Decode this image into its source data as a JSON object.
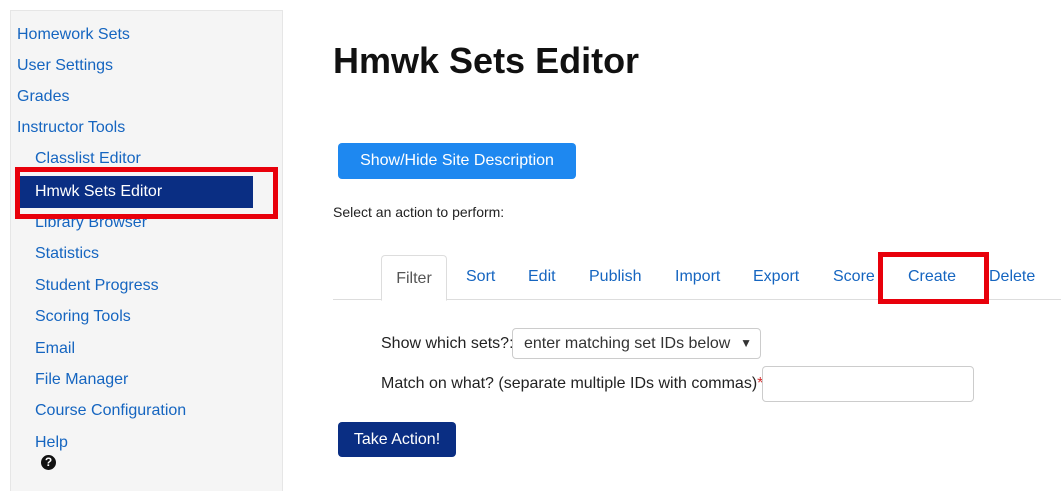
{
  "sidebar": {
    "items": [
      {
        "label": "Homework Sets"
      },
      {
        "label": "User Settings"
      },
      {
        "label": "Grades"
      },
      {
        "label": "Instructor Tools"
      },
      {
        "label": "Classlist Editor"
      },
      {
        "label": "Hmwk Sets Editor"
      },
      {
        "label": "Library Browser"
      },
      {
        "label": "Statistics"
      },
      {
        "label": "Student Progress"
      },
      {
        "label": "Scoring Tools"
      },
      {
        "label": "Email"
      },
      {
        "label": "File Manager"
      },
      {
        "label": "Course Configuration"
      },
      {
        "label": "Help"
      }
    ],
    "help_icon": "question-circle-icon"
  },
  "main": {
    "title": "Hmwk Sets Editor",
    "toggle_button": "Show/Hide Site Description",
    "prompt": "Select an action to perform:",
    "tabs": [
      {
        "label": "Filter"
      },
      {
        "label": "Sort"
      },
      {
        "label": "Edit"
      },
      {
        "label": "Publish"
      },
      {
        "label": "Import"
      },
      {
        "label": "Export"
      },
      {
        "label": "Score"
      },
      {
        "label": "Create"
      },
      {
        "label": "Delete"
      }
    ],
    "active_tab": "Filter",
    "form": {
      "show_label": "Show which sets?:",
      "select_value": "enter matching set IDs below",
      "match_label": "Match on what? (separate multiple IDs with commas)",
      "required_mark": "*",
      "match_suffix": ":",
      "match_value": ""
    },
    "action_button": "Take Action!"
  },
  "colors": {
    "link": "#1565c0",
    "active_nav": "#0a2e83",
    "primary_button": "#1e88f0",
    "highlight": "#e8000b"
  }
}
